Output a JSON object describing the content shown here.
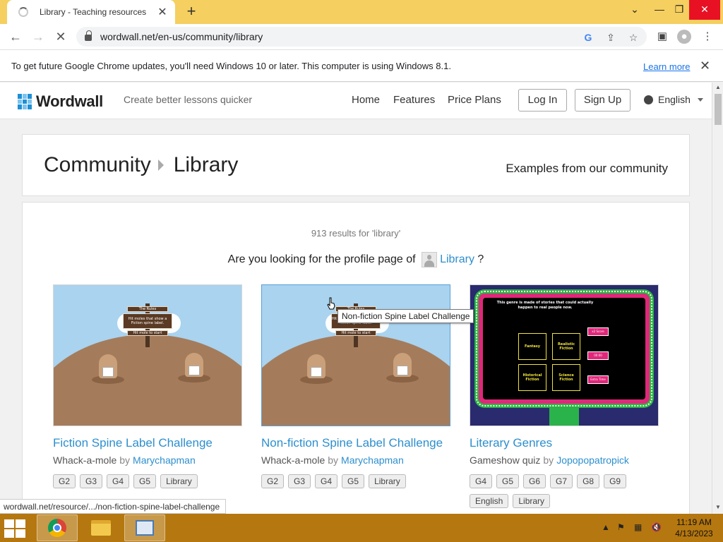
{
  "browser": {
    "tab_title": "Library - Teaching resources",
    "tab_close": "✕",
    "new_tab": "+",
    "url": "wordwall.net/en-us/community/library",
    "win_min": "—",
    "win_restore": "❐",
    "win_close": "✕",
    "tabs_menu": "⌄"
  },
  "infobar": {
    "message": "To get future Google Chrome updates, you'll need Windows 10 or later. This computer is using Windows 8.1.",
    "learn_more": "Learn more",
    "close": "✕"
  },
  "header": {
    "logo": "Wordwall",
    "tagline": "Create better lessons quicker",
    "nav": [
      "Home",
      "Features",
      "Price Plans"
    ],
    "login": "Log In",
    "signup": "Sign Up",
    "language": "English"
  },
  "breadcrumb": {
    "root": "Community",
    "current": "Library",
    "subtitle": "Examples from our community"
  },
  "results": {
    "count_text": "913 results for 'library'",
    "profile_prefix": "Are you looking for the profile page of",
    "profile_name": "Library",
    "profile_suffix": "?"
  },
  "cards": [
    {
      "title": "Fiction Spine Label Challenge",
      "type": "Whack-a-mole",
      "by": "by",
      "author": "Marychapman",
      "tags": [
        "G2",
        "G3",
        "G4",
        "G5",
        "Library"
      ],
      "thumb_lines": [
        "The Rules",
        "Hit moles that show a Fiction spine label.",
        "Hit mole to start"
      ]
    },
    {
      "title": "Non-fiction Spine Label Challenge",
      "type": "Whack-a-mole",
      "by": "by",
      "author": "Marychapman",
      "tags": [
        "G2",
        "G3",
        "G4",
        "G5",
        "Library"
      ],
      "thumb_lines": [
        "The Rules",
        "Hit moles that show a Non-fiction spine label.",
        "Hit mole to start"
      ]
    },
    {
      "title": "Literary Genres",
      "type": "Gameshow quiz",
      "by": "by",
      "author": "Jopopopatropick",
      "tags": [
        "G4",
        "G5",
        "G6",
        "G7",
        "G8",
        "G9",
        "English",
        "Library"
      ],
      "thumb_question": "This genre is made of stories that could actually happen to real people now.",
      "thumb_answers": [
        "Fantasy",
        "Realistic Fiction",
        "Historical Fiction",
        "Science Fiction"
      ],
      "thumb_buttons": [
        "x2 Score",
        "00:00",
        "Extra Time"
      ]
    }
  ],
  "tooltip": "Non-fiction Spine Label Challenge",
  "status_url": "wordwall.net/resource/.../non-fiction-spine-label-challenge",
  "taskbar": {
    "time": "11:19 AM",
    "date": "4/13/2023"
  }
}
